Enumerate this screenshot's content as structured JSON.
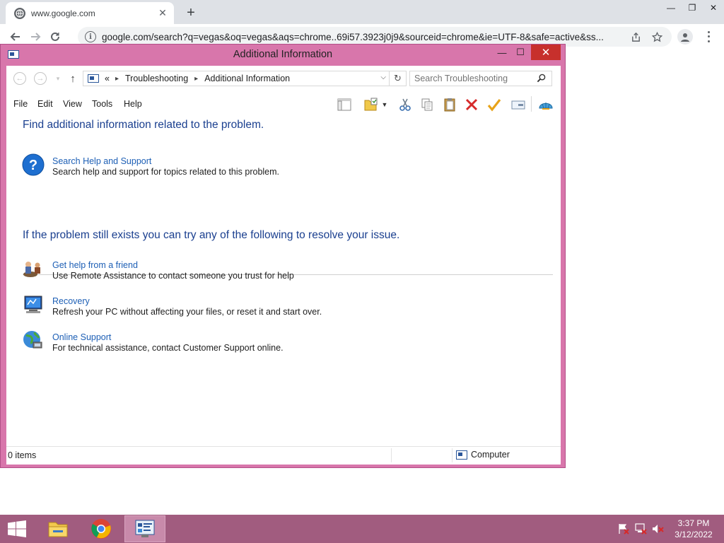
{
  "browser": {
    "tab_title": "www.google.com",
    "url": "google.com/search?q=vegas&oq=vegas&aqs=chrome..69i57.3923j0j9&sourceid=chrome&ie=UTF-8&safe=active&ss..."
  },
  "window": {
    "title": "Additional Information",
    "breadcrumb": [
      "Troubleshooting",
      "Additional Information"
    ],
    "breadcrumb_prefix": "«",
    "search_placeholder": "Search Troubleshooting",
    "menu": [
      "File",
      "Edit",
      "View",
      "Tools",
      "Help"
    ]
  },
  "content": {
    "heading1": "Find additional information related to the problem.",
    "help_link": "Search Help and Support",
    "help_desc": "Search help and support for topics related to this problem.",
    "heading2": "If the problem still exists you can try any of the following to resolve your issue.",
    "tasks": [
      {
        "link": "Get help from a friend",
        "desc": "Use Remote Assistance to contact someone you trust for help",
        "icon": "remote-assistance-icon"
      },
      {
        "link": "Recovery",
        "desc": "Refresh your PC without affecting your files, or reset it and start over.",
        "icon": "recovery-icon"
      },
      {
        "link": "Online Support",
        "desc": "For technical assistance, contact Customer Support online.",
        "icon": "globe-icon"
      }
    ]
  },
  "status": {
    "items": "0 items",
    "location": "Computer"
  },
  "taskbar": {
    "time": "3:37 PM",
    "date": "3/12/2022"
  },
  "colors": {
    "accent": "#d876ab",
    "taskbar": "#a15c7f",
    "link": "#1d5fb5",
    "heading": "#1a3f8f"
  }
}
